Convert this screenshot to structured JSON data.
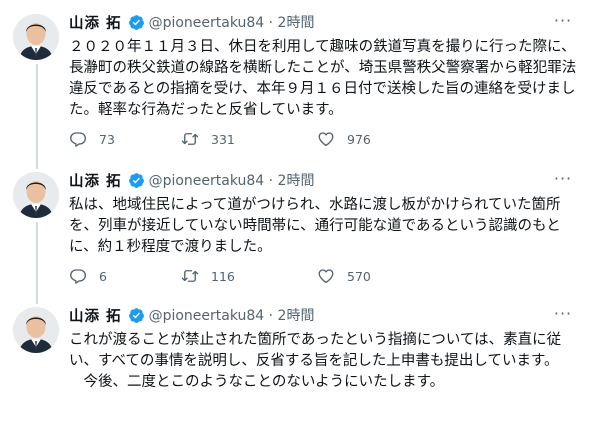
{
  "tweets": [
    {
      "author_name": "山添 拓",
      "handle_time": "@pioneertaku84 · 2時間",
      "text": "２０２０年１１月３日、休日を利用して趣味の鉄道写真を撮りに行った際に、長瀞町の秩父鉄道の線路を横断したことが、埼玉県警秩父警察署から軽犯罪法違反であるとの指摘を受け、本年９月１６日付で送検した旨の連絡を受けました。軽率な行為だったと反省しています。",
      "replies": "73",
      "retweets": "331",
      "likes": "976"
    },
    {
      "author_name": "山添 拓",
      "handle_time": "@pioneertaku84 · 2時間",
      "text": "私は、地域住民によって道がつけられ、水路に渡し板がかけられていた箇所を、列車が接近していない時間帯に、通行可能な道であるという認識のもとに、約１秒程度で渡りました。",
      "replies": "6",
      "retweets": "116",
      "likes": "570"
    },
    {
      "author_name": "山添 拓",
      "handle_time": "@pioneertaku84 · 2時間",
      "text": "これが渡ることが禁止された箇所であったという指摘については、素直に従い、すべての事情を説明し、反省する旨を記した上申書も提出しています。",
      "text2": "今後、二度とこのようなことのないようにいたします。"
    }
  ],
  "more_label": "···",
  "colors": {
    "verified": "#1d9bf0",
    "icon": "#536471",
    "thread_line": "#cfd9de"
  },
  "icons": [
    "verified-badge-icon",
    "reply-icon",
    "retweet-icon",
    "like-icon",
    "more-icon"
  ]
}
